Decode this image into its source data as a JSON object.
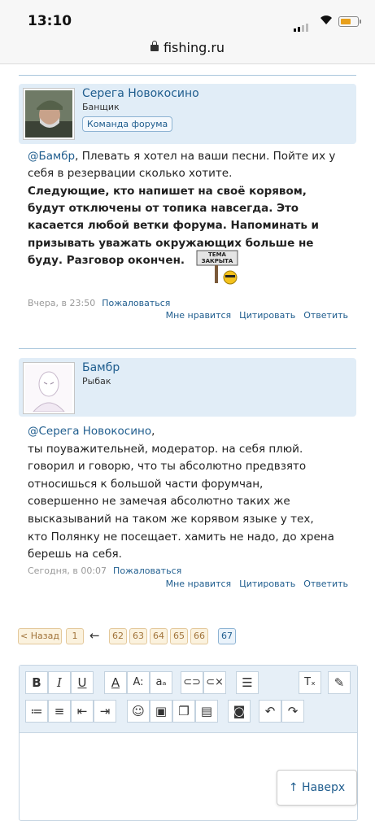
{
  "status_bar": {
    "time": "13:10"
  },
  "browser": {
    "url": "fishing.ru"
  },
  "posts": [
    {
      "author": "Серега Новокосино",
      "role": "Банщик",
      "badge": "Команда форума",
      "mention": "@Бамбр",
      "text_plain": ", Плевать я хотел на ваши песни. Пойте их у себя в резервации сколько хотите.",
      "text_bold": "Следующие, кто напишет на своё корявом, будут отключены от топика навсегда. Это касается любой ветки форума. Напоминать и призывать уважать окружающих больше не буду. Разговор окончен.",
      "sticker_text": "ТЕМА ЗАКРЫТА",
      "time": "Вчера, в 23:50",
      "report": "Пожаловаться",
      "like": "Мне нравится",
      "quote": "Цитировать",
      "reply": "Ответить"
    },
    {
      "author": "Бамбр",
      "role": "Рыбак",
      "mention": "@Серега Новокосино",
      "text_plain": "ты поуважительней, модератор. на себя плюй. говорил и говорю, что ты абсолютно предвзято относишься к большой части форумчан, совершенно не замечая абсолютно таких же высказываний на таком же корявом языке у тех, кто Полянку не посещает. хамить не надо, до хрена берешь на себя.",
      "time": "Сегодня, в 00:07",
      "report": "Пожаловаться",
      "like": "Мне нравится",
      "quote": "Цитировать",
      "reply": "Ответить"
    }
  ],
  "pagination": {
    "prev": "< Назад",
    "first": "1",
    "ellipsis_arrow": "←",
    "pages": [
      "62",
      "63",
      "64",
      "65",
      "66",
      "67"
    ],
    "current": "67"
  },
  "editor": {
    "row1_icons": [
      "bold-icon",
      "italic-icon",
      "underline-icon",
      "text-color-icon",
      "font-size-icon",
      "font-style-icon",
      "link-icon",
      "unlink-icon",
      "align-icon",
      "remove-format-icon",
      "preview-icon"
    ],
    "row2_icons": [
      "bullet-list-icon",
      "numbered-list-icon",
      "outdent-icon",
      "indent-icon",
      "smiley-icon",
      "image-icon",
      "media-icon",
      "video-icon",
      "save-icon",
      "undo-icon",
      "redo-icon"
    ]
  },
  "scroll_top": "↑ Наверх"
}
